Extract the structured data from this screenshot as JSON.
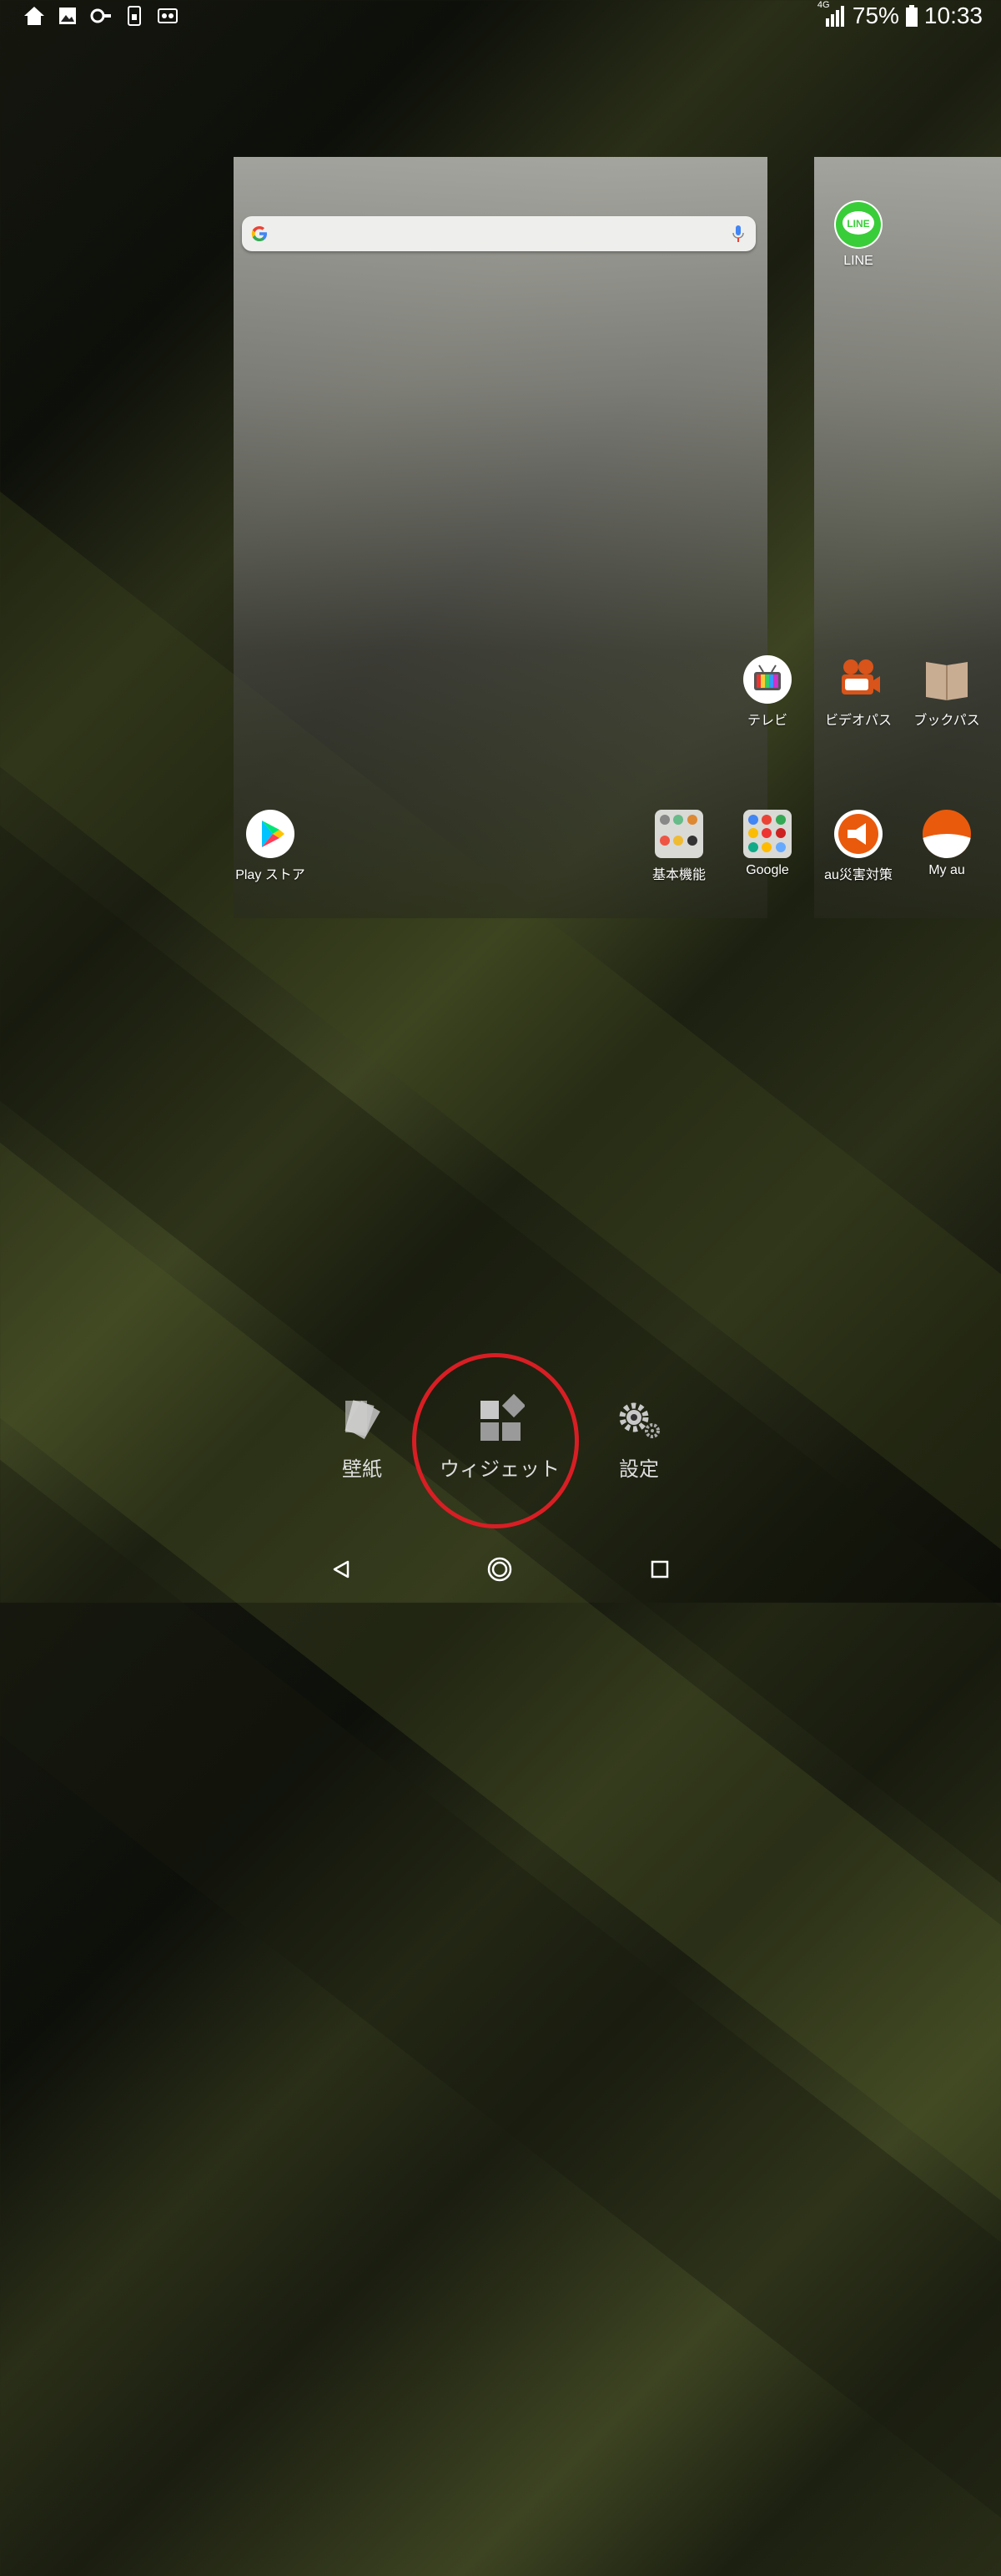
{
  "status_bar": {
    "left_icons": [
      "home-icon",
      "image-icon",
      "key-icon",
      "sim-icon",
      "cassette-icon"
    ],
    "network": "4G",
    "battery": "75%",
    "time": "10:33"
  },
  "home_panels": {
    "left": {
      "search_bar": {
        "icons": [
          "google-g-icon",
          "mic-icon"
        ]
      },
      "apps": [
        {
          "label": "テレビ"
        },
        {
          "label": "Play ストア"
        },
        {
          "label": "基本機能"
        },
        {
          "label": "Google"
        }
      ]
    },
    "right": {
      "apps": [
        {
          "label": "LINE"
        },
        {
          "label": "ビデオパス"
        },
        {
          "label": "ブックパス"
        },
        {
          "label": "au災害対策"
        },
        {
          "label": "My au"
        }
      ]
    }
  },
  "edit_menu": {
    "items": [
      {
        "label": "壁紙",
        "icon": "wallpaper-icon"
      },
      {
        "label": "ウィジェット",
        "icon": "widgets-icon"
      },
      {
        "label": "設定",
        "icon": "settings-gear-icon"
      }
    ],
    "highlight_color": "#d81e24"
  },
  "nav_bar": {
    "buttons": [
      "back-icon",
      "home-circle-icon",
      "recents-square-icon"
    ]
  }
}
